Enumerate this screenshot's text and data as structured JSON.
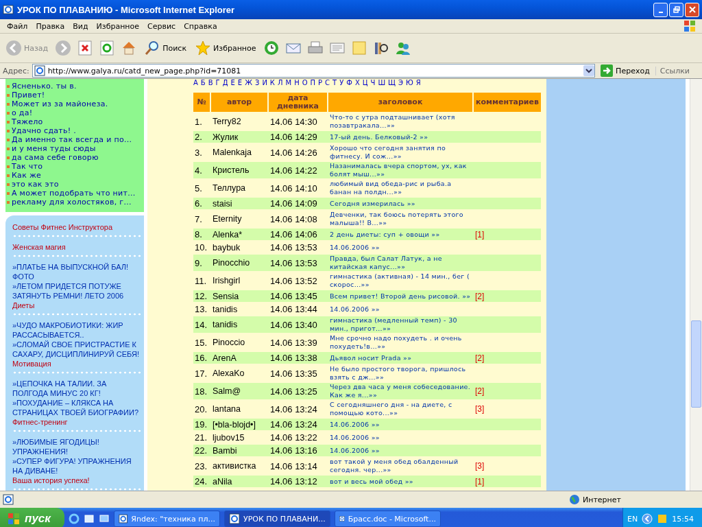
{
  "window": {
    "title": "УРОК ПО ПЛАВАНИЮ - Microsoft Internet Explorer"
  },
  "menu": [
    "Файл",
    "Правка",
    "Вид",
    "Избранное",
    "Сервис",
    "Справка"
  ],
  "toolbar": {
    "back": "Назад",
    "search": "Поиск",
    "favorites": "Избранное"
  },
  "address": {
    "label": "Адрес:",
    "url": "http://www.galya.ru/catd_new_page.php?id=71081",
    "go": "Переход",
    "links": "Ссылки"
  },
  "recent_posts": [
    "Ясненько. ты в.",
    "Привет!",
    "Может из за майонеза.",
    "о да!",
    "Тяжело",
    "Удачно сдать! .",
    "Да именно так всегда и по...",
    "и у меня туды сюды",
    "да сама себе говорю",
    "Так что",
    "Как же",
    "это как это",
    "А может подобрать что нит...",
    "рекламу для холостяков, г..."
  ],
  "sections": [
    {
      "title": "Советы Фитнес Инструктора"
    },
    {
      "title": "Женская магия",
      "links": [
        "»ПЛАТЬЕ НА ВЫПУСКНОЙ БАЛ! ФОТО",
        "»ЛЕТОМ ПРИДЕТСЯ ПОТУЖЕ ЗАТЯНУТЬ РЕМНИ! ЛЕТО 2006"
      ]
    },
    {
      "title": "Диеты",
      "links": [
        "»ЧУДО МАКРОБИОТИКИ: ЖИР РАССАСЫВАЕТСЯ..",
        "»СЛОМАЙ СВОЕ ПРИСТРАСТИЕ К САХАРУ, ДИСЦИПЛИНИРУЙ СЕБЯ!"
      ]
    },
    {
      "title": "Мотивация",
      "links": [
        "»ЦЕПОЧКА НА ТАЛИИ. ЗА ПОЛГОДА МИНУС 20 КГ!",
        "»ПОХУДАНИЕ – КЛЯКСА НА СТРАНИЦАХ ТВОЕЙ БИОГРАФИИ?"
      ]
    },
    {
      "title": "Фитнес-тренинг",
      "links": [
        "»ЛЮБИМЫЕ ЯГОДИЦЫ! УПРАЖНЕНИЯ!",
        "»СУПЕР ФИГУРА! УПРАЖНЕНИЯ НА ДИВАНЕ!"
      ]
    },
    {
      "title": "Ваша история успеха!"
    }
  ],
  "alphabet": [
    "А",
    "Б",
    "В",
    "Г",
    "Д",
    "Е",
    "Ё",
    "Ж",
    "З",
    "И",
    "К",
    "Л",
    "М",
    "Н",
    "О",
    "П",
    "Р",
    "С",
    "Т",
    "У",
    "Ф",
    "Х",
    "Ц",
    "Ч",
    "Ш",
    "Щ",
    "Э",
    "Ю",
    "Я"
  ],
  "table": {
    "columns": [
      "№",
      "автор",
      "дата дневника",
      "заголовок",
      "комментариев"
    ],
    "rows": [
      {
        "n": "1.",
        "author": "Terry82",
        "date": "14.06 14:30",
        "title": "Что-то с утра подташнивает (хотя позавтракала...»»"
      },
      {
        "n": "2.",
        "author": "Жулик",
        "date": "14.06 14:29",
        "title": "17-ый день. Белковый-2 »»"
      },
      {
        "n": "3.",
        "author": "Malenkaja",
        "date": "14.06 14:26",
        "title": "Хорошо что сегодня занятия по фитнесу. И сож...»»"
      },
      {
        "n": "4.",
        "author": "Кристель",
        "date": "14.06 14:22",
        "title": "Назанималась вчера спортом, ух, как болят мыш...»»"
      },
      {
        "n": "5.",
        "author": "Теллура",
        "date": "14.06 14:10",
        "title": "любимый вид обеда-рис и рыба.а банан на полдн...»»"
      },
      {
        "n": "6.",
        "author": "staisi",
        "date": "14.06 14:09",
        "title": "Сегодня измерилась »»"
      },
      {
        "n": "7.",
        "author": "Eternity",
        "date": "14.06 14:08",
        "title": "Девченки, так боюсь потерять этого малыша!! В...»»"
      },
      {
        "n": "8.",
        "author": "Alenka*",
        "date": "14.06 14:06",
        "title": "2 день диеты: суп + овощи »»",
        "comments": "[1]"
      },
      {
        "n": "10.",
        "author": "baybuk",
        "date": "14.06 13:53",
        "title": "14.06.2006 »»"
      },
      {
        "n": "9.",
        "author": "Pinocchio",
        "date": "14.06 13:53",
        "title": "Правда, был Салат Латук, а не китайская капус...»»"
      },
      {
        "n": "11.",
        "author": "Irishgirl",
        "date": "14.06 13:52",
        "title": "гимнастика (активная) - 14 мин., бег ( скорос...»»"
      },
      {
        "n": "12.",
        "author": "Sensia",
        "date": "14.06 13:45",
        "title": "Всем привет! Второй день рисовой. »»",
        "comments": "[2]"
      },
      {
        "n": "13.",
        "author": "tanidis",
        "date": "14.06 13:44",
        "title": "14.06.2006 »»"
      },
      {
        "n": "14.",
        "author": "tanidis",
        "date": "14.06 13:40",
        "title": "гимнастика (медленный темп) - 30 мин., пригот...»»"
      },
      {
        "n": "15.",
        "author": "Pinoccio",
        "date": "14.06 13:39",
        "title": "Мне срочно надо похудеть . и очень похудеть!в...»»"
      },
      {
        "n": "16.",
        "author": "ArenA",
        "date": "14.06 13:38",
        "title": "Дьявол носит Prada »»",
        "comments": "[2]"
      },
      {
        "n": "17.",
        "author": "AlexaKo",
        "date": "14.06 13:35",
        "title": "Не было простого творога, пришлось взять с дж...»»"
      },
      {
        "n": "18.",
        "author": "Salm@",
        "date": "14.06 13:25",
        "title": "Через два часа у меня собеседование. Как же я...»»",
        "comments": "[2]"
      },
      {
        "n": "20.",
        "author": "lantana",
        "date": "14.06 13:24",
        "title": "С сегодняшнего дня - на диете, с помощью кото...»»",
        "comments": "[3]"
      },
      {
        "n": "19.",
        "author": "[•bla-blojd•]",
        "date": "14.06 13:24",
        "title": "14.06.2006 »»"
      },
      {
        "n": "21.",
        "author": "ljubov15",
        "date": "14.06 13:22",
        "title": "14.06.2006 »»"
      },
      {
        "n": "22.",
        "author": "Bambi",
        "date": "14.06 13:16",
        "title": "14.06.2006 »»"
      },
      {
        "n": "23.",
        "author": "активистка",
        "date": "14.06 13:14",
        "title": "вот такой у меня обед обалденный сегодня. чер...»»",
        "comments": "[3]"
      },
      {
        "n": "24.",
        "author": "aNila",
        "date": "14.06 13:12",
        "title": "вот и весь мой обед »»",
        "comments": "[1]"
      }
    ]
  },
  "status_bar": {
    "zone": "Интернет"
  },
  "taskbar": {
    "start": "пуск",
    "tasks": [
      {
        "label": "Яndex: \"техника пл...",
        "selected": false
      },
      {
        "label": "УРОК ПО ПЛАВАНИ...",
        "selected": true
      },
      {
        "label": "Брасс.doc - Microsoft...",
        "selected": false
      }
    ],
    "language": "EN",
    "clock": "15:54"
  }
}
